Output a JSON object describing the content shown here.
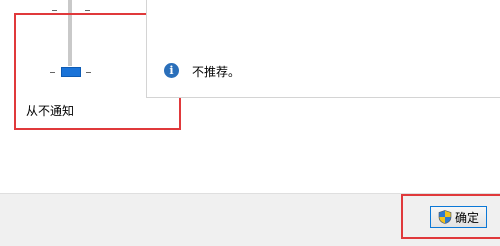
{
  "slider": {
    "level_label": "从不通知",
    "level": 0,
    "level_count": 4
  },
  "description": {
    "text": "不推荐。",
    "icon": "info-icon"
  },
  "buttons": {
    "ok_label": "确定",
    "ok_icon": "uac-shield-icon"
  },
  "colors": {
    "highlight": "#e0393b",
    "thumb": "#1a73d8",
    "info_icon": "#2a6fba"
  }
}
